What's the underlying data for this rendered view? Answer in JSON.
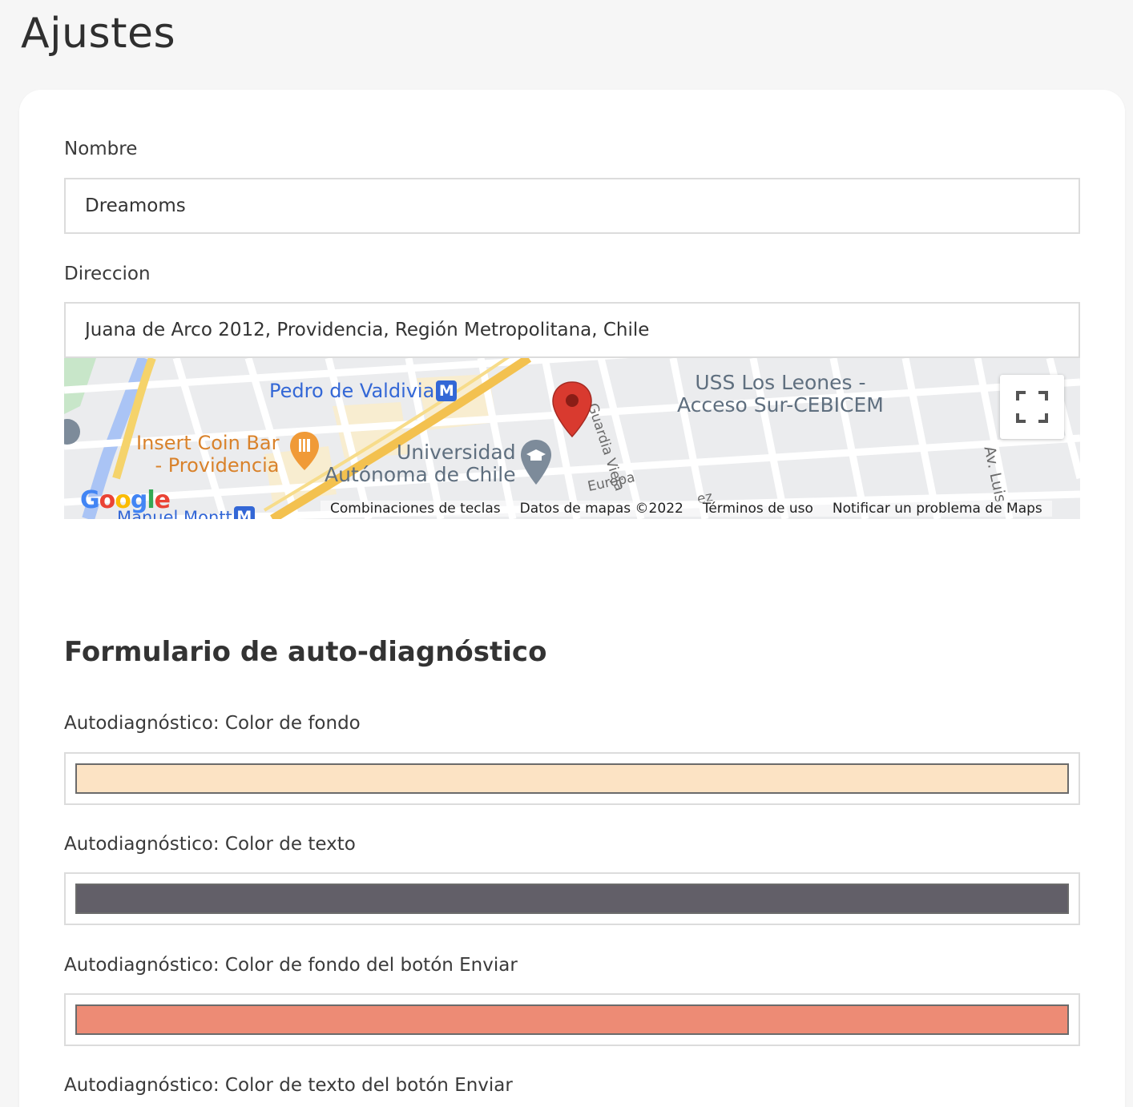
{
  "page": {
    "title": "Ajustes"
  },
  "form": {
    "nombre": {
      "label": "Nombre",
      "value": "Dreamoms"
    },
    "direccion": {
      "label": "Direccion",
      "value": "Juana de Arco 2012, Providencia, Región Metropolitana, Chile"
    }
  },
  "map": {
    "places": {
      "pedro_de_valdivia": "Pedro de Valdivia",
      "metro_symbol": "M",
      "insert_coin_line1": "Insert Coin Bar",
      "insert_coin_line2": "- Providencia",
      "universidad_line1": "Universidad",
      "universidad_line2": "Autónoma de Chile",
      "uss_line1": "USS Los Leones -",
      "uss_line2": "Acceso Sur-CEBICEM",
      "manuel_montt": "Manuel Montt"
    },
    "streets": {
      "guardia_vieja": "Guardia Vieja",
      "europa": "Europa",
      "av_luis": "Av. Luis",
      "partial": "ez"
    },
    "footer": {
      "shortcuts": "Combinaciones de teclas",
      "map_data": "Datos de mapas ©2022",
      "terms": "Términos de uso",
      "report": "Notificar un problema de Maps"
    },
    "brand": "Google",
    "marker_color": "#d93a2f"
  },
  "autodiagnostico": {
    "section_title": "Formulario de auto-diagnóstico",
    "fields": [
      {
        "label": "Autodiagnóstico: Color de fondo",
        "color": "#fce3c4"
      },
      {
        "label": "Autodiagnóstico: Color de texto",
        "color": "#625f68"
      },
      {
        "label": "Autodiagnóstico: Color de fondo del botón Enviar",
        "color": "#ed8b75"
      },
      {
        "label": "Autodiagnóstico: Color de texto del botón Enviar"
      }
    ]
  }
}
